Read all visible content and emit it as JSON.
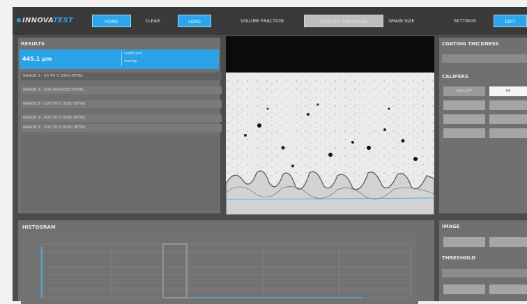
{
  "app": {
    "logo_prefix": "INNOVA",
    "logo_suffix": "TEST"
  },
  "toolbar": {
    "home": "HOME",
    "clear": "CLEAR",
    "load": "LOAD",
    "volume_fraction": "VOLUME FRACTION",
    "coating_thickness": "COATING THICKNESS",
    "grain_size": "GRAIN SIZE",
    "settings": "SETTINGS",
    "edit": "EDIT"
  },
  "results": {
    "title": "RESULTS",
    "main_value": "445.1 µm",
    "side_line_1": "coefficient",
    "side_line_2": "overlay",
    "rows": [
      "RANGE 0 - 50 TO 0.3000 (BTW)",
      "RANGE 0 - 200 AREA/SECTIONS",
      "RANGE 0 - 300 TO 0.3000 (BTW)",
      "RANGE 0 - 400 TO 0.3000 (BTW)",
      "RANGE 0 - 500 TO 0.3000 (BTW)"
    ]
  },
  "coating_panel": {
    "title": "COATING THICKNESS",
    "field_placeholder": "",
    "calipers_title": "CALIPERS",
    "calipers_select": "WALLET",
    "calipers_value": "50"
  },
  "histogram": {
    "title": "HISTOGRAM",
    "y_ticks": [
      "",
      "",
      "",
      "",
      "",
      "",
      "",
      ""
    ],
    "x_ticks": [
      "",
      "",
      "",
      "",
      "",
      "",
      ""
    ]
  },
  "image_panel": {
    "title": "IMAGE",
    "threshold_title": "THRESHOLD"
  }
}
